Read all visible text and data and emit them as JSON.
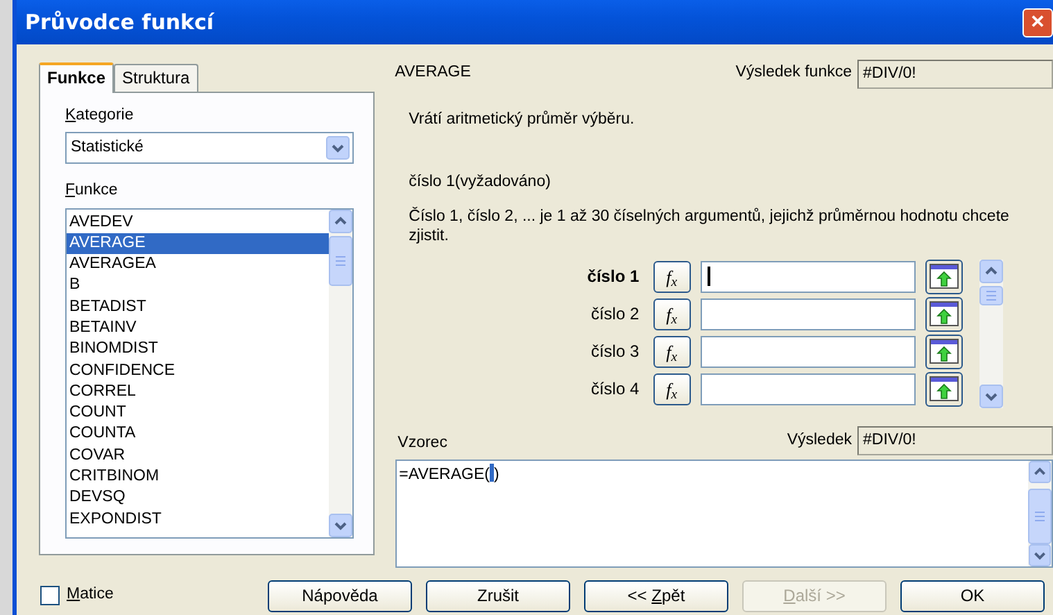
{
  "window": {
    "title": "Průvodce funkcí",
    "close": "✕"
  },
  "tabs": [
    {
      "label": "Funkce",
      "selected": true
    },
    {
      "label": "Struktura",
      "selected": false
    }
  ],
  "category": {
    "label": "Kategorie",
    "underlined_first": true,
    "value": "Statistické"
  },
  "functions": {
    "label": "Funkce",
    "underlined_first": true,
    "items": [
      {
        "name": "AVEDEV",
        "selected": false
      },
      {
        "name": "AVERAGE",
        "selected": true
      },
      {
        "name": "AVERAGEA",
        "selected": false
      },
      {
        "name": "B",
        "selected": false
      },
      {
        "name": "BETADIST",
        "selected": false
      },
      {
        "name": "BETAINV",
        "selected": false
      },
      {
        "name": "BINOMDIST",
        "selected": false
      },
      {
        "name": "CONFIDENCE",
        "selected": false
      },
      {
        "name": "CORREL",
        "selected": false
      },
      {
        "name": "COUNT",
        "selected": false
      },
      {
        "name": "COUNTA",
        "selected": false
      },
      {
        "name": "COVAR",
        "selected": false
      },
      {
        "name": "CRITBINOM",
        "selected": false
      },
      {
        "name": "DEVSQ",
        "selected": false
      },
      {
        "name": "EXPONDIST",
        "selected": false
      }
    ]
  },
  "matrix": {
    "label": "Matice",
    "underlined_first": true,
    "checked": false
  },
  "function_name": "AVERAGE",
  "function_result": {
    "label": "Výsledek funkce",
    "value": "#DIV/0!"
  },
  "description": "Vrátí aritmetický průměr výběru.",
  "argument_title": "číslo 1(vyžadováno)",
  "argument_description": "Číslo 1, číslo 2, ... je 1 až 30 číselných argumentů, jejichž průměrnou hodnotu chcete zjistit.",
  "arguments": [
    {
      "label": "číslo 1",
      "required": true,
      "focused": true,
      "fx": "f$_{x}$"
    },
    {
      "label": "číslo 2",
      "required": false,
      "focused": false,
      "fx": "f$_{x}$"
    },
    {
      "label": "číslo 3",
      "required": false,
      "focused": false,
      "fx": "f$_{x}$"
    },
    {
      "label": "číslo 4",
      "required": false,
      "focused": false,
      "fx": "f$_{x}$"
    }
  ],
  "formula": {
    "label": "Vzorec",
    "before_cursor": "=AVERAGE(",
    "after_cursor": ")"
  },
  "result": {
    "label": "Výsledek",
    "value": "#DIV/0!"
  },
  "buttons": [
    {
      "label": "Nápověda",
      "disabled": false,
      "underlined_first": false
    },
    {
      "label": "Zrušit",
      "disabled": false,
      "underlined_first": false
    },
    {
      "prefix": "<<",
      "label": "Zpět",
      "disabled": false,
      "underlined_first": true
    },
    {
      "label": "Další >>",
      "disabled": true,
      "underlined_first": true
    },
    {
      "label": "OK",
      "disabled": false,
      "underlined_first": false
    }
  ]
}
